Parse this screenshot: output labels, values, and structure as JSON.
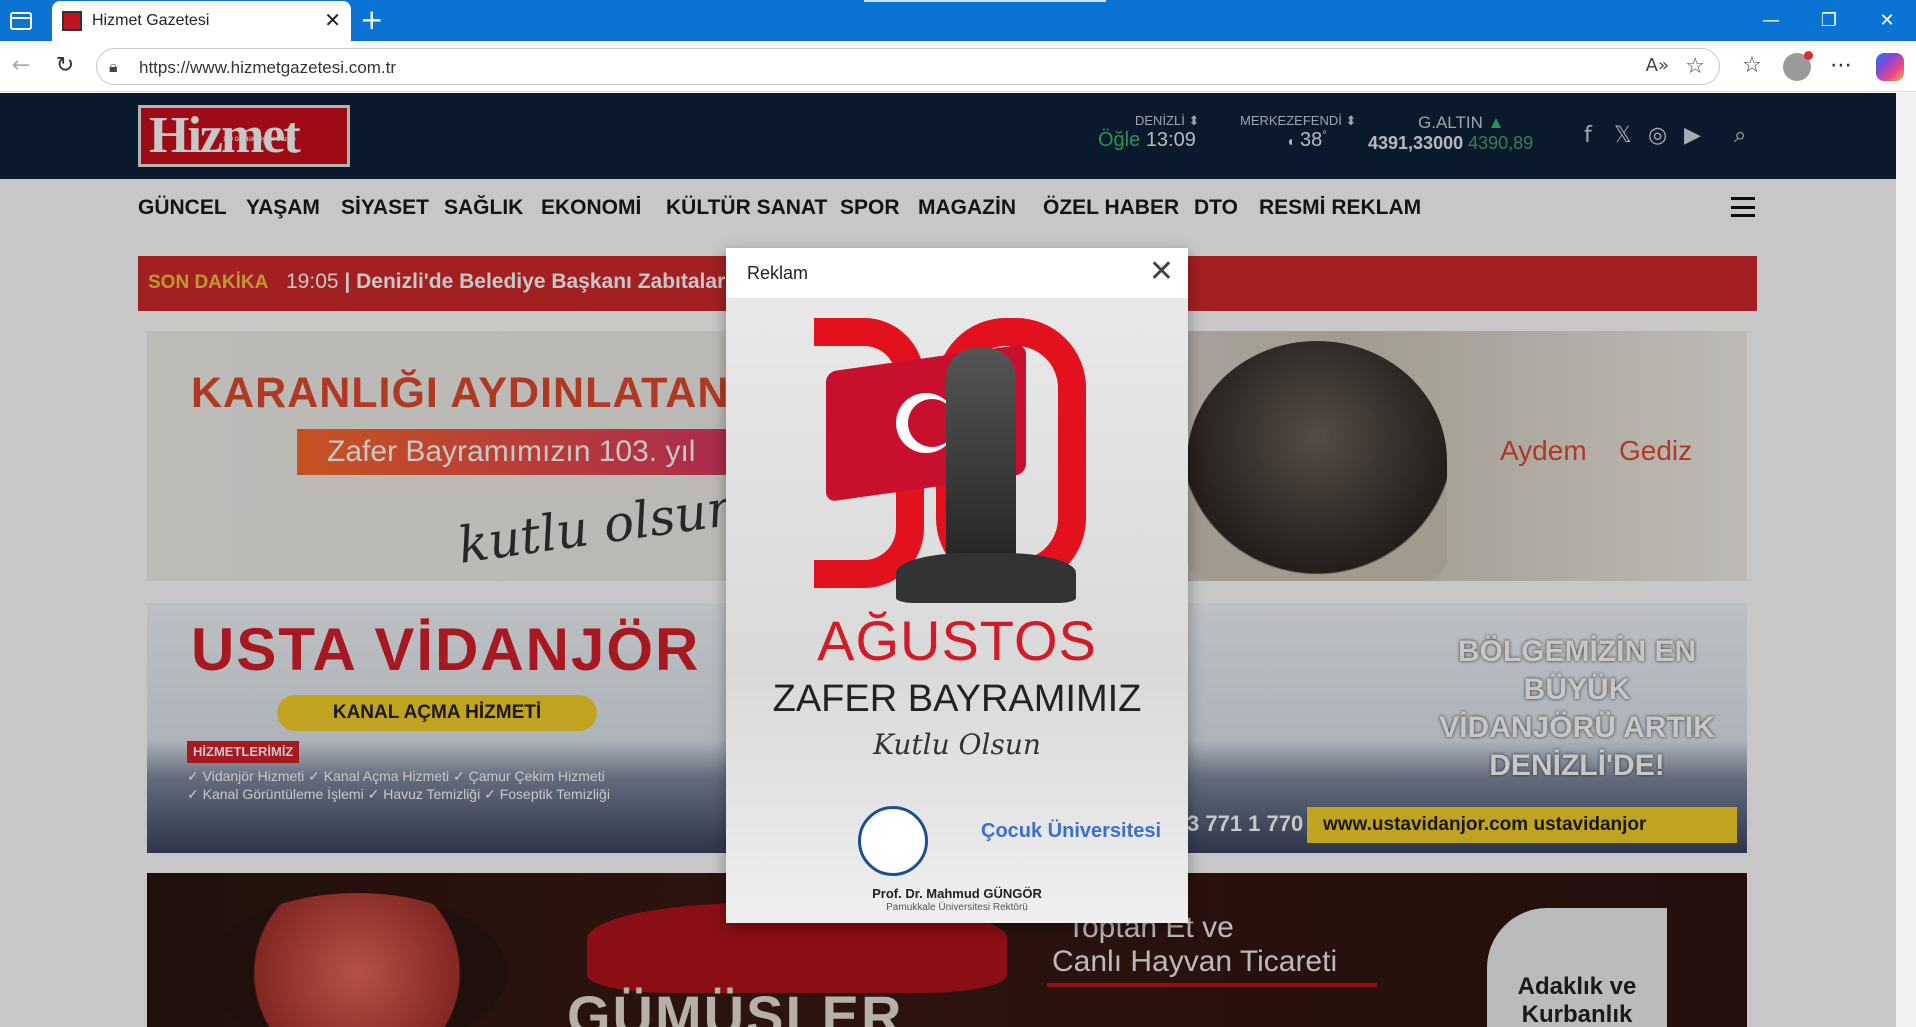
{
  "browser": {
    "tab_title": "Hizmet Gazetesi",
    "url": "https://www.hizmetgazetesi.com.tr",
    "icons": [
      "sidebar-icon",
      "close-icon",
      "plus-icon",
      "back-icon",
      "refresh-icon",
      "lock-icon",
      "read-aloud-icon",
      "star-icon",
      "favorites-icon",
      "profile-icon",
      "more-icon",
      "copilot-icon",
      "minimize-icon",
      "restore-icon",
      "window-close-icon"
    ],
    "win_min": "—",
    "win_max": "❐",
    "win_close": "✕"
  },
  "site": {
    "logo_text": "Hizmet",
    "logo_tag": "100 Günlük Siyasi Gazete",
    "prayer": {
      "city": "DENİZLİ",
      "name": "Öğle",
      "time": "13:09"
    },
    "weather": {
      "district": "MERKEZEFENDİ",
      "temp": "38"
    },
    "gold": {
      "label": "G.ALTIN",
      "value": "4391,33000",
      "prev": "4390,89"
    },
    "social": [
      "facebook-icon",
      "x-icon",
      "instagram-icon",
      "youtube-icon"
    ],
    "nav": [
      "GÜNCEL",
      "YAŞAM",
      "SİYASET",
      "SAĞLIK",
      "EKONOMİ",
      "KÜLTÜR SANAT",
      "SPOR",
      "MAGAZİN",
      "ÖZEL HABER",
      "DTO",
      "RESMİ REKLAM"
    ],
    "breaking": {
      "label": "SON DAKİKA",
      "time": "19:05",
      "headline": "Denizli'de Belediye Başkanı Zabıtaları"
    }
  },
  "ads": {
    "ad1": {
      "headline": "KARANLIĞI AYDINLATAN B",
      "pill": "Zafer Bayramımızın 103. yıl",
      "hand": "kutlu olsun!",
      "brand1": "Aydem",
      "brand2": "Gediz"
    },
    "ad2": {
      "headline": "USTA VİDANJÖR",
      "service": "KANAL AÇMA HİZMETİ",
      "services_title": "HİZMETLERİMİZ",
      "services": "✓ Vidanjör Hizmeti ✓ Kanal Açma Hizmeti ✓ Çamur Çekim Hizmeti ✓ Kanal Görüntüleme İşlemi ✓ Havuz Temizliği ✓ Foseptik Temizliği",
      "right": "BÖLGEMİZİN EN BÜYÜK VİDANJÖRÜ ARTIK DENİZLİ'DE!",
      "phone": "3 771 1 770",
      "web": "www.ustavidanjor.com  ustavidanjor"
    },
    "ad3": {
      "brand": "GÜMÜŞLER",
      "line1": "Toptan Et ve",
      "line2": "Canlı Hayvan Ticareti",
      "corner": "Adaklık ve Kurbanlık"
    }
  },
  "modal": {
    "title": "Reklam",
    "close": "✕",
    "poster": {
      "month": "AĞUSTOS",
      "holiday": "ZAFER BAYRAMIMIZ",
      "wish": "Kutlu Olsun",
      "uni2": "Çocuk Üniversitesi",
      "person": "Prof. Dr. Mahmud GÜNGÖR",
      "role": "Pamukkale Üniversitesi Rektörü"
    }
  }
}
